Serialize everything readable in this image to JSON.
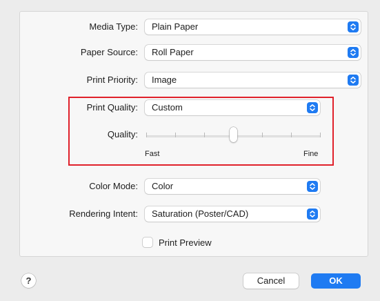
{
  "fields": {
    "media_type": {
      "label": "Media Type:",
      "value": "Plain Paper"
    },
    "paper_source": {
      "label": "Paper Source:",
      "value": "Roll Paper"
    },
    "print_priority": {
      "label": "Print Priority:",
      "value": "Image"
    },
    "print_quality": {
      "label": "Print Quality:",
      "value": "Custom"
    },
    "color_mode": {
      "label": "Color Mode:",
      "value": "Color"
    },
    "rendering_intent": {
      "label": "Rendering Intent:",
      "value": "Saturation (Poster/CAD)"
    }
  },
  "quality_slider": {
    "label": "Quality:",
    "min_label": "Fast",
    "max_label": "Fine",
    "value_fraction": 0.5,
    "tick_count": 7
  },
  "print_preview": {
    "label": "Print Preview",
    "checked": false
  },
  "buttons": {
    "help": "?",
    "cancel": "Cancel",
    "ok": "OK"
  },
  "colors": {
    "accent": "#1f7bf2",
    "highlight": "#e0202a"
  }
}
